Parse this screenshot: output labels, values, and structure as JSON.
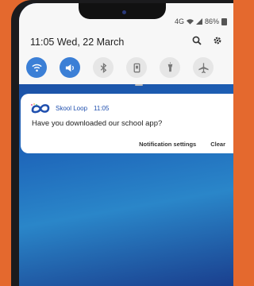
{
  "status_bar": {
    "signal_text": "4G",
    "battery_text": "86%"
  },
  "header": {
    "time": "11:05",
    "date": "Wed, 22 March",
    "search_icon": "search-icon",
    "settings_icon": "gear-icon"
  },
  "quick_settings": [
    {
      "name": "wifi",
      "active": true
    },
    {
      "name": "sound",
      "active": true
    },
    {
      "name": "bluetooth",
      "active": false
    },
    {
      "name": "portrait-lock",
      "active": false
    },
    {
      "name": "flashlight",
      "active": false
    },
    {
      "name": "airplane-mode",
      "active": false
    }
  ],
  "notification": {
    "app_name": "Skool Loop",
    "time": "11:05",
    "message": "Have you downloaded our school app?",
    "actions": {
      "settings": "Notification settings",
      "clear": "Clear"
    }
  },
  "colors": {
    "accent": "#3b7fd6",
    "background": "#e4692e",
    "app_text": "#1f4fae"
  }
}
